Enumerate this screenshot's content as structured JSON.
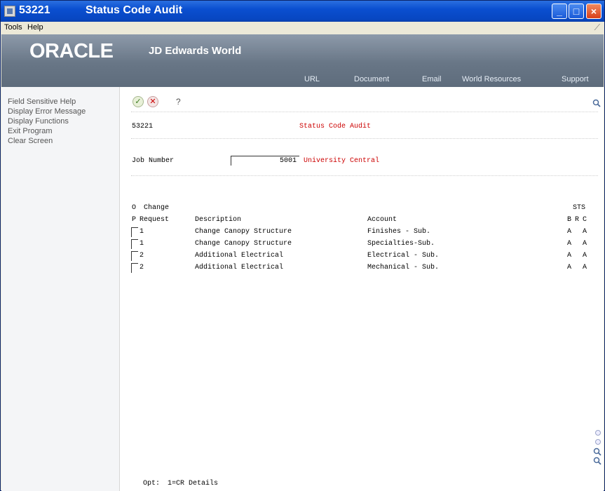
{
  "window": {
    "code": "53221",
    "title": "Status Code Audit"
  },
  "menu": {
    "tools": "Tools",
    "help": "Help"
  },
  "banner": {
    "brand": "ORACLE",
    "product": "JD Edwards World",
    "links": [
      "URL",
      "Document",
      "Email",
      "World Resources",
      "Support"
    ]
  },
  "sidebar": {
    "items": [
      "Field Sensitive Help",
      "Display Error Message",
      "Display Functions",
      "Exit Program",
      "Clear Screen"
    ]
  },
  "toolbar": {
    "help_symbol": "?"
  },
  "form": {
    "program_id": "53221",
    "form_title": "Status Code Audit",
    "job_label": "Job Number",
    "job_value": "5001",
    "job_description": "University Central"
  },
  "grid": {
    "header_o": "O",
    "header_change": "Change",
    "header_p": "P",
    "header_request": "Request",
    "header_description": "Description",
    "header_account": "Account",
    "header_sts": "STS",
    "header_b": "B",
    "header_r": "R",
    "header_c": "C",
    "rows": [
      {
        "request": "1",
        "description": "Change Canopy Structure",
        "account": "Finishes - Sub.",
        "b": "A",
        "r": "",
        "c": "A"
      },
      {
        "request": "1",
        "description": "Change Canopy Structure",
        "account": "Specialties-Sub.",
        "b": "A",
        "r": "",
        "c": "A"
      },
      {
        "request": "2",
        "description": "Additional Electrical",
        "account": "Electrical - Sub.",
        "b": "A",
        "r": "",
        "c": "A"
      },
      {
        "request": "2",
        "description": "Additional Electrical",
        "account": "Mechanical - Sub.",
        "b": "A",
        "r": "",
        "c": "A"
      }
    ]
  },
  "footer": {
    "opt_label": "Opt:",
    "opt_text": "1=CR Details"
  },
  "colors": {
    "title_bar": "#0a4fd0",
    "banner": "#6b7889",
    "form_title": "#cc0000"
  }
}
